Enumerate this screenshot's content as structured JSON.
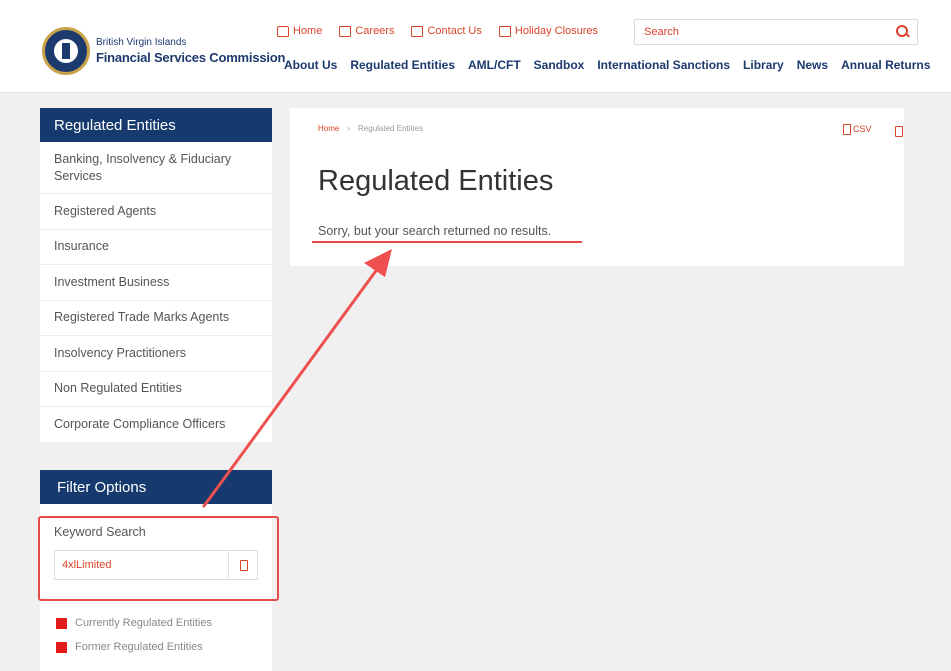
{
  "header": {
    "logo_line1": "British Virgin Islands",
    "logo_line2": "Financial Services Commission",
    "top_links": [
      "Home",
      "Careers",
      "Contact Us",
      "Holiday Closures"
    ],
    "search_placeholder": "Search",
    "nav": [
      "About Us",
      "Regulated Entities",
      "AML/CFT",
      "Sandbox",
      "International Sanctions",
      "Library",
      "News",
      "Annual Returns"
    ]
  },
  "sidebar": {
    "title": "Regulated Entities",
    "items": [
      "Banking, Insolvency & Fiduciary Services",
      "Registered Agents",
      "Insurance",
      "Investment Business",
      "Registered Trade Marks Agents",
      "Insolvency Practitioners",
      "Non Regulated Entities",
      "Corporate Compliance Officers"
    ]
  },
  "filter": {
    "title": "Filter Options",
    "keyword_label": "Keyword Search",
    "keyword_value": "4xlLimited",
    "checkboxes": [
      "Currently Regulated Entities",
      "Former Regulated Entities"
    ]
  },
  "content": {
    "breadcrumb": [
      "Home",
      "›",
      "Regulated Entities"
    ],
    "title": "Regulated Entities",
    "message": "Sorry, but your search returned no results.",
    "csv_label": "CSV"
  },
  "colors": {
    "navy": "#163a6d",
    "accent": "#d9432a",
    "annotation": "#e44a4a"
  }
}
